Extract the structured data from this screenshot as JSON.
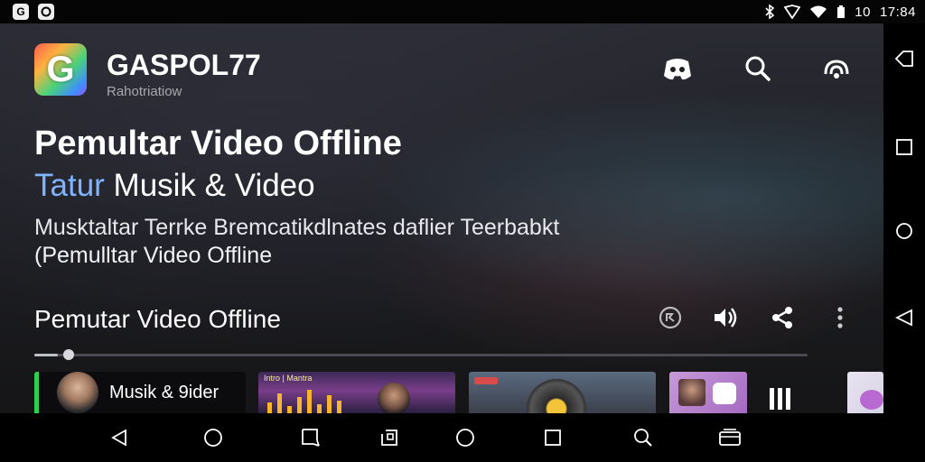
{
  "status_bar": {
    "left_icons": [
      "G",
      "app-icon"
    ],
    "right_text_1": "10",
    "right_text_2": "17:84"
  },
  "header": {
    "logo_letter": "G",
    "app_name": "GASPOL77",
    "app_subtitle": "Rahotriatiow",
    "icons": [
      "discord-icon",
      "search-icon",
      "cast-icon"
    ]
  },
  "hero": {
    "title": "Pemultar Video Offline",
    "subtitle_highlight": "Tatur",
    "subtitle_rest": " Musik & Video",
    "description_line1": "Musktaltar Terrke Bremcatikdlnates daflier Teerbabkt",
    "description_line2": "(Pemulltar Video Offline"
  },
  "player": {
    "title": "Pemutar Video Offline",
    "controls": [
      "replay-icon",
      "volume-icon",
      "share-icon",
      "more-vert-icon"
    ],
    "progress": 0.03
  },
  "thumbnails": [
    {
      "label": "Musik & 9ider"
    },
    {
      "label": "Intro | Mantra"
    },
    {
      "label": ""
    },
    {
      "label": ""
    },
    {
      "label": ""
    }
  ],
  "colors": {
    "accent_green": "#2fd04f",
    "accent_blue": "#7fb4ff"
  },
  "rail_icons": [
    "back-outline-icon",
    "square-icon",
    "circle-icon",
    "back-triangle-icon"
  ],
  "nav_icons": [
    "back-icon",
    "home-icon",
    "crop-icon",
    "screenshot-icon",
    "home-circle-icon",
    "recents-icon",
    "search-icon",
    "keyboard-icon"
  ]
}
